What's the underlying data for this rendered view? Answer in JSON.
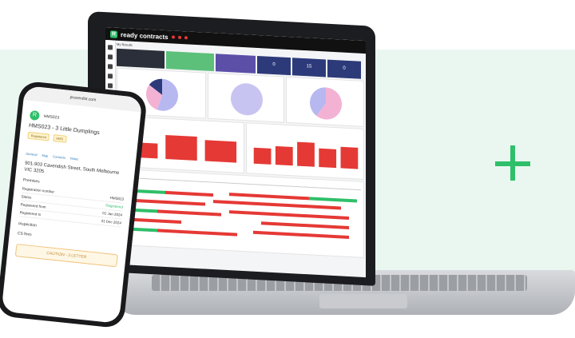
{
  "colors": {
    "band": "#eaf7f1",
    "accent": "#2fbf6a",
    "bar_red": "#e53935",
    "bar_green": "#2fbf6a",
    "pie_blue": "#b8b8f0",
    "pie_pink": "#f3b2d4",
    "pie_navy": "#2d3a7a"
  },
  "app": {
    "brand": "ready contracts",
    "logo_letter": "R"
  },
  "laptop": {
    "breadcrumb": "My Results",
    "tiles": [
      "",
      "",
      "",
      "",
      "0",
      "15",
      "0"
    ],
    "cards": [
      "",
      "",
      "",
      "",
      "",
      "",
      ""
    ]
  },
  "phone": {
    "url": "proverdist.com",
    "org": "HMS023",
    "title": "HMS023 - 3 Little Dumplings",
    "badges": [
      "Registered",
      "HMS"
    ],
    "tabs": [
      "General",
      "Map",
      "Contacts",
      "Notes"
    ],
    "address": "901-903 Cavendish Street, South Melbourne VIC 3205",
    "section": "Premises",
    "rows": [
      {
        "k": "Registration number",
        "v": "HMS023"
      },
      {
        "k": "Status",
        "v": "Registered",
        "green": true
      },
      {
        "k": "Registered from",
        "v": "01 Jan 2024"
      },
      {
        "k": "Registered to",
        "v": "31 Dec 2024"
      }
    ],
    "inspection": "Inspection",
    "fee_label": "CS fees",
    "action": "CAUTION - 3 LETTER"
  },
  "chart_data": [
    {
      "type": "pie",
      "values": [
        55,
        30,
        15
      ],
      "colors": [
        "#b8b8f0",
        "#f3b2d4",
        "#2d3a7a"
      ]
    },
    {
      "type": "pie",
      "values": [
        100
      ],
      "colors": [
        "#c8c4f2"
      ]
    },
    {
      "type": "pie",
      "values": [
        60,
        40
      ],
      "colors": [
        "#f3b2d4",
        "#b8b8f0"
      ]
    },
    {
      "type": "bar",
      "values": [
        10,
        16,
        14
      ],
      "colors": [
        "#e53935"
      ]
    },
    {
      "type": "bar",
      "values": [
        6,
        7,
        9,
        7,
        8
      ],
      "colors": [
        "#e53935"
      ]
    }
  ]
}
